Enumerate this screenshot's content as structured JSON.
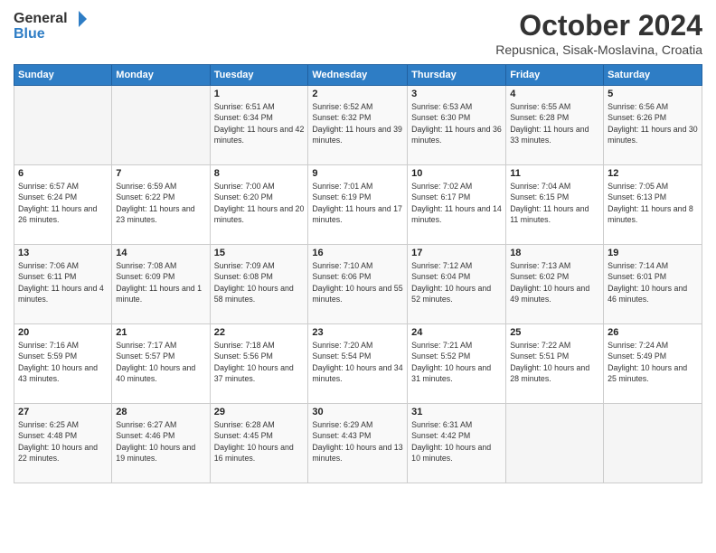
{
  "header": {
    "logo_line1": "General",
    "logo_line2": "Blue",
    "month": "October 2024",
    "location": "Repusnica, Sisak-Moslavina, Croatia"
  },
  "weekdays": [
    "Sunday",
    "Monday",
    "Tuesday",
    "Wednesday",
    "Thursday",
    "Friday",
    "Saturday"
  ],
  "weeks": [
    [
      {
        "day": "",
        "sunrise": "",
        "sunset": "",
        "daylight": ""
      },
      {
        "day": "",
        "sunrise": "",
        "sunset": "",
        "daylight": ""
      },
      {
        "day": "1",
        "sunrise": "Sunrise: 6:51 AM",
        "sunset": "Sunset: 6:34 PM",
        "daylight": "Daylight: 11 hours and 42 minutes."
      },
      {
        "day": "2",
        "sunrise": "Sunrise: 6:52 AM",
        "sunset": "Sunset: 6:32 PM",
        "daylight": "Daylight: 11 hours and 39 minutes."
      },
      {
        "day": "3",
        "sunrise": "Sunrise: 6:53 AM",
        "sunset": "Sunset: 6:30 PM",
        "daylight": "Daylight: 11 hours and 36 minutes."
      },
      {
        "day": "4",
        "sunrise": "Sunrise: 6:55 AM",
        "sunset": "Sunset: 6:28 PM",
        "daylight": "Daylight: 11 hours and 33 minutes."
      },
      {
        "day": "5",
        "sunrise": "Sunrise: 6:56 AM",
        "sunset": "Sunset: 6:26 PM",
        "daylight": "Daylight: 11 hours and 30 minutes."
      }
    ],
    [
      {
        "day": "6",
        "sunrise": "Sunrise: 6:57 AM",
        "sunset": "Sunset: 6:24 PM",
        "daylight": "Daylight: 11 hours and 26 minutes."
      },
      {
        "day": "7",
        "sunrise": "Sunrise: 6:59 AM",
        "sunset": "Sunset: 6:22 PM",
        "daylight": "Daylight: 11 hours and 23 minutes."
      },
      {
        "day": "8",
        "sunrise": "Sunrise: 7:00 AM",
        "sunset": "Sunset: 6:20 PM",
        "daylight": "Daylight: 11 hours and 20 minutes."
      },
      {
        "day": "9",
        "sunrise": "Sunrise: 7:01 AM",
        "sunset": "Sunset: 6:19 PM",
        "daylight": "Daylight: 11 hours and 17 minutes."
      },
      {
        "day": "10",
        "sunrise": "Sunrise: 7:02 AM",
        "sunset": "Sunset: 6:17 PM",
        "daylight": "Daylight: 11 hours and 14 minutes."
      },
      {
        "day": "11",
        "sunrise": "Sunrise: 7:04 AM",
        "sunset": "Sunset: 6:15 PM",
        "daylight": "Daylight: 11 hours and 11 minutes."
      },
      {
        "day": "12",
        "sunrise": "Sunrise: 7:05 AM",
        "sunset": "Sunset: 6:13 PM",
        "daylight": "Daylight: 11 hours and 8 minutes."
      }
    ],
    [
      {
        "day": "13",
        "sunrise": "Sunrise: 7:06 AM",
        "sunset": "Sunset: 6:11 PM",
        "daylight": "Daylight: 11 hours and 4 minutes."
      },
      {
        "day": "14",
        "sunrise": "Sunrise: 7:08 AM",
        "sunset": "Sunset: 6:09 PM",
        "daylight": "Daylight: 11 hours and 1 minute."
      },
      {
        "day": "15",
        "sunrise": "Sunrise: 7:09 AM",
        "sunset": "Sunset: 6:08 PM",
        "daylight": "Daylight: 10 hours and 58 minutes."
      },
      {
        "day": "16",
        "sunrise": "Sunrise: 7:10 AM",
        "sunset": "Sunset: 6:06 PM",
        "daylight": "Daylight: 10 hours and 55 minutes."
      },
      {
        "day": "17",
        "sunrise": "Sunrise: 7:12 AM",
        "sunset": "Sunset: 6:04 PM",
        "daylight": "Daylight: 10 hours and 52 minutes."
      },
      {
        "day": "18",
        "sunrise": "Sunrise: 7:13 AM",
        "sunset": "Sunset: 6:02 PM",
        "daylight": "Daylight: 10 hours and 49 minutes."
      },
      {
        "day": "19",
        "sunrise": "Sunrise: 7:14 AM",
        "sunset": "Sunset: 6:01 PM",
        "daylight": "Daylight: 10 hours and 46 minutes."
      }
    ],
    [
      {
        "day": "20",
        "sunrise": "Sunrise: 7:16 AM",
        "sunset": "Sunset: 5:59 PM",
        "daylight": "Daylight: 10 hours and 43 minutes."
      },
      {
        "day": "21",
        "sunrise": "Sunrise: 7:17 AM",
        "sunset": "Sunset: 5:57 PM",
        "daylight": "Daylight: 10 hours and 40 minutes."
      },
      {
        "day": "22",
        "sunrise": "Sunrise: 7:18 AM",
        "sunset": "Sunset: 5:56 PM",
        "daylight": "Daylight: 10 hours and 37 minutes."
      },
      {
        "day": "23",
        "sunrise": "Sunrise: 7:20 AM",
        "sunset": "Sunset: 5:54 PM",
        "daylight": "Daylight: 10 hours and 34 minutes."
      },
      {
        "day": "24",
        "sunrise": "Sunrise: 7:21 AM",
        "sunset": "Sunset: 5:52 PM",
        "daylight": "Daylight: 10 hours and 31 minutes."
      },
      {
        "day": "25",
        "sunrise": "Sunrise: 7:22 AM",
        "sunset": "Sunset: 5:51 PM",
        "daylight": "Daylight: 10 hours and 28 minutes."
      },
      {
        "day": "26",
        "sunrise": "Sunrise: 7:24 AM",
        "sunset": "Sunset: 5:49 PM",
        "daylight": "Daylight: 10 hours and 25 minutes."
      }
    ],
    [
      {
        "day": "27",
        "sunrise": "Sunrise: 6:25 AM",
        "sunset": "Sunset: 4:48 PM",
        "daylight": "Daylight: 10 hours and 22 minutes."
      },
      {
        "day": "28",
        "sunrise": "Sunrise: 6:27 AM",
        "sunset": "Sunset: 4:46 PM",
        "daylight": "Daylight: 10 hours and 19 minutes."
      },
      {
        "day": "29",
        "sunrise": "Sunrise: 6:28 AM",
        "sunset": "Sunset: 4:45 PM",
        "daylight": "Daylight: 10 hours and 16 minutes."
      },
      {
        "day": "30",
        "sunrise": "Sunrise: 6:29 AM",
        "sunset": "Sunset: 4:43 PM",
        "daylight": "Daylight: 10 hours and 13 minutes."
      },
      {
        "day": "31",
        "sunrise": "Sunrise: 6:31 AM",
        "sunset": "Sunset: 4:42 PM",
        "daylight": "Daylight: 10 hours and 10 minutes."
      },
      {
        "day": "",
        "sunrise": "",
        "sunset": "",
        "daylight": ""
      },
      {
        "day": "",
        "sunrise": "",
        "sunset": "",
        "daylight": ""
      }
    ]
  ]
}
